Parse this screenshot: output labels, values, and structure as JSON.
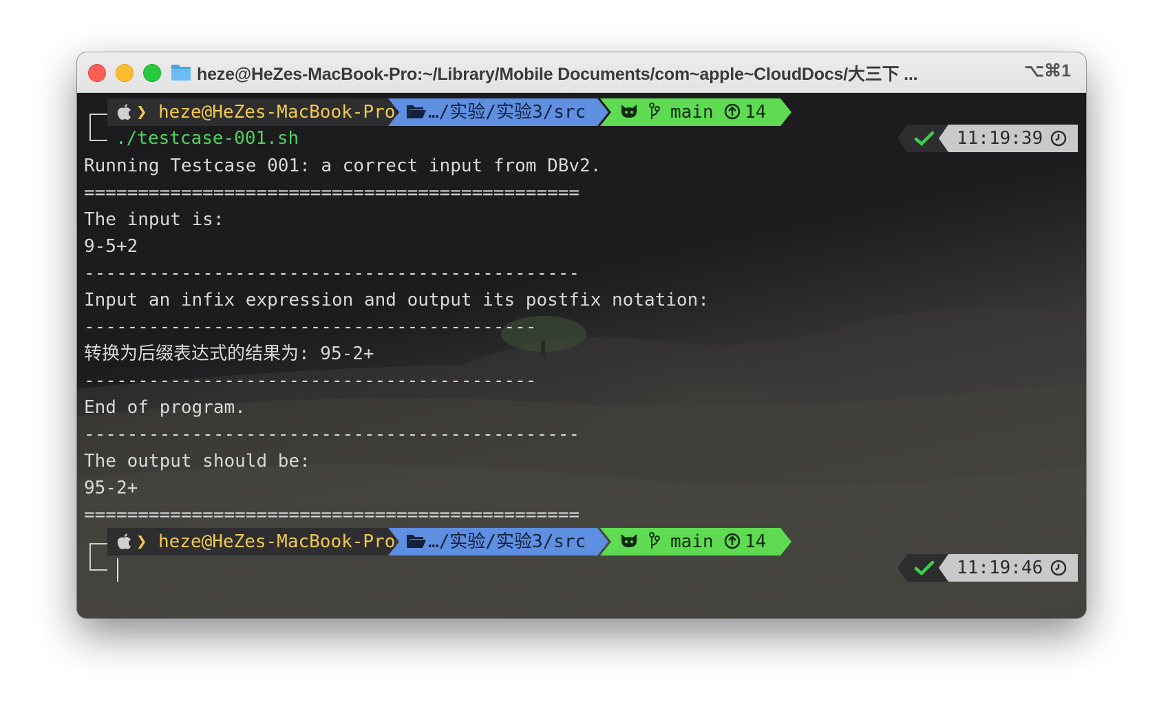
{
  "window": {
    "title": "heze@HeZes-MacBook-Pro:~/Library/Mobile Documents/com~apple~CloudDocs/大三下 ...",
    "shortcut": "⌥⌘1"
  },
  "prompt": {
    "user_host": "heze@HeZes-MacBook-Pro",
    "path": "…/实验/实验3/src",
    "branch": "main",
    "ahead": "14"
  },
  "command": "./testcase-001.sh",
  "first_status": {
    "time": "11:19:39"
  },
  "second_status": {
    "time": "11:19:46"
  },
  "output": [
    "Running Testcase 001: a correct input from DBv2.",
    "==============================================",
    "The input is:",
    "9-5+2",
    "----------------------------------------------",
    "Input an infix expression and output its postfix notation:",
    "------------------------------------------",
    "转换为后缀表达式的结果为: 95-2+",
    "------------------------------------------",
    "End of program.",
    "----------------------------------------------",
    "The output should be:",
    "95-2+",
    "=============================================="
  ],
  "colors": {
    "user_fg": "#f2c94c",
    "path_bg": "#5e8fe0",
    "git_bg": "#5edb52",
    "check": "#3ecf4a",
    "command_fg": "#4fd35a"
  }
}
